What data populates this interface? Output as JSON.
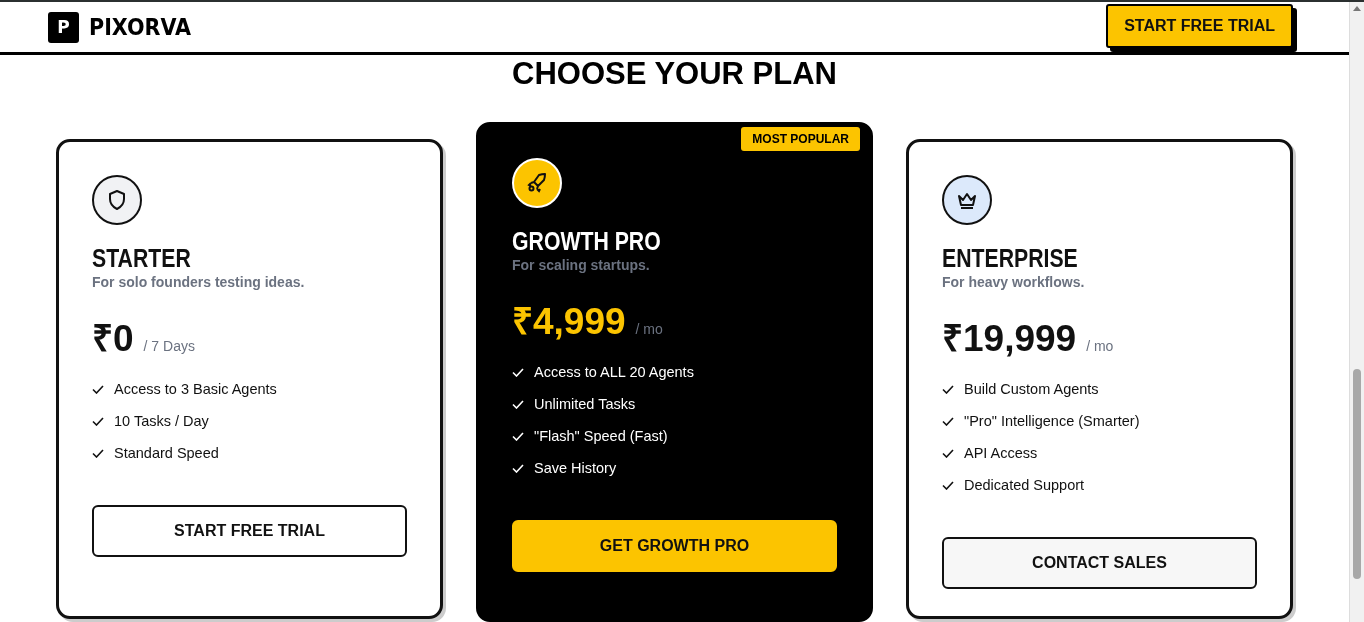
{
  "header": {
    "logo_letter": "P",
    "brand": "PIXORVA",
    "cta": "START FREE TRIAL"
  },
  "heading": "CHOOSE YOUR PLAN",
  "plans": [
    {
      "kind": "basic",
      "name": "STARTER",
      "tagline": "For solo founders testing ideas.",
      "price": "₹0",
      "period": "/ 7 Days",
      "features": [
        "Access to 3 Basic Agents",
        "10 Tasks / Day",
        "Standard Speed"
      ],
      "button": "START FREE TRIAL"
    },
    {
      "kind": "featured",
      "badge": "MOST POPULAR",
      "name": "GROWTH PRO",
      "tagline": "For scaling startups.",
      "price": "₹4,999",
      "period": "/ mo",
      "features": [
        "Access to ALL 20 Agents",
        "Unlimited Tasks",
        "\"Flash\" Speed (Fast)",
        "Save History"
      ],
      "button": "GET GROWTH PRO"
    },
    {
      "kind": "premium",
      "name": "ENTERPRISE",
      "tagline": "For heavy workflows.",
      "price": "₹19,999",
      "period": "/ mo",
      "features": [
        "Build Custom Agents",
        "\"Pro\" Intelligence (Smarter)",
        "API Access",
        "Dedicated Support"
      ],
      "button": "CONTACT SALES"
    }
  ]
}
